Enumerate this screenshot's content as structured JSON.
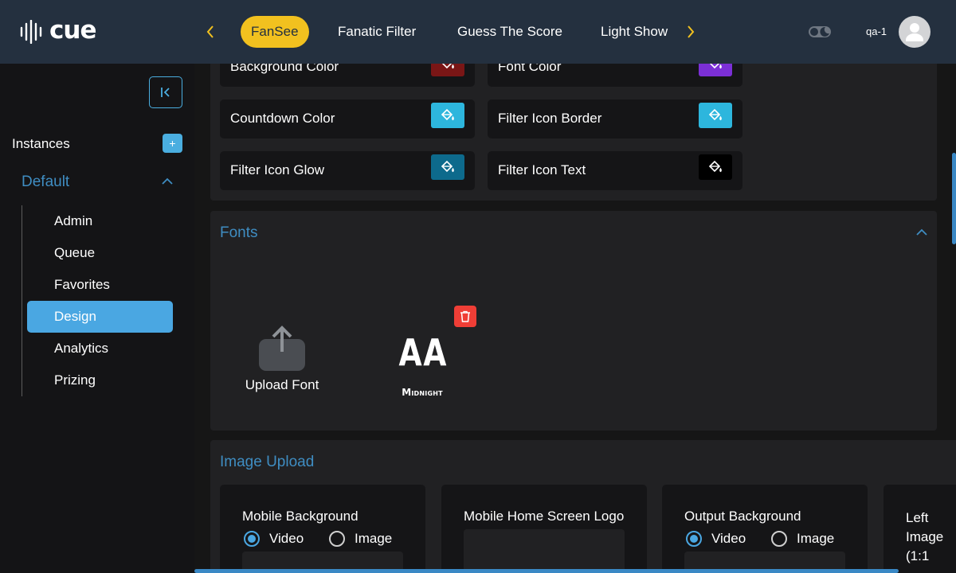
{
  "brand": {
    "name": "cue"
  },
  "header": {
    "tabs": [
      {
        "label": "FanSee",
        "active": true
      },
      {
        "label": "Fanatic Filter",
        "active": false
      },
      {
        "label": "Guess The Score",
        "active": false
      },
      {
        "label": "Light Show",
        "active": false
      }
    ],
    "user": "qa-1"
  },
  "sidebar": {
    "instances_label": "Instances",
    "add_label": "+",
    "group": "Default",
    "items": [
      {
        "label": "Admin",
        "active": false
      },
      {
        "label": "Queue",
        "active": false
      },
      {
        "label": "Favorites",
        "active": false
      },
      {
        "label": "Design",
        "active": true
      },
      {
        "label": "Analytics",
        "active": false
      },
      {
        "label": "Prizing",
        "active": false
      }
    ]
  },
  "colors": [
    {
      "label": "Background Color",
      "value": "#7a1616"
    },
    {
      "label": "Font Color",
      "value": "#7b2fd6"
    },
    {
      "label": "Countdown Color",
      "value": "#2db6dd"
    },
    {
      "label": "Filter Icon Border",
      "value": "#2db6dd"
    },
    {
      "label": "Filter Icon Glow",
      "value": "#0d6a8c"
    },
    {
      "label": "Filter Icon Text",
      "value": "#000000"
    }
  ],
  "fonts": {
    "title": "Fonts",
    "upload_label": "Upload Font",
    "items": [
      {
        "sample": "AA",
        "name": "Midnight"
      }
    ]
  },
  "image_upload": {
    "title": "Image Upload",
    "cards": [
      {
        "title": "Mobile Background",
        "options": [
          "Video",
          "Image"
        ],
        "selected": "Video"
      },
      {
        "title": "Mobile Home Screen Logo"
      },
      {
        "title": "Output Background",
        "options": [
          "Video",
          "Image"
        ],
        "selected": "Video"
      },
      {
        "title": "Left Image (1:1"
      }
    ]
  },
  "theme": {
    "accent": "#4aa7e2",
    "tab_active": "#f2c11f",
    "header_bg": "#24303f"
  }
}
